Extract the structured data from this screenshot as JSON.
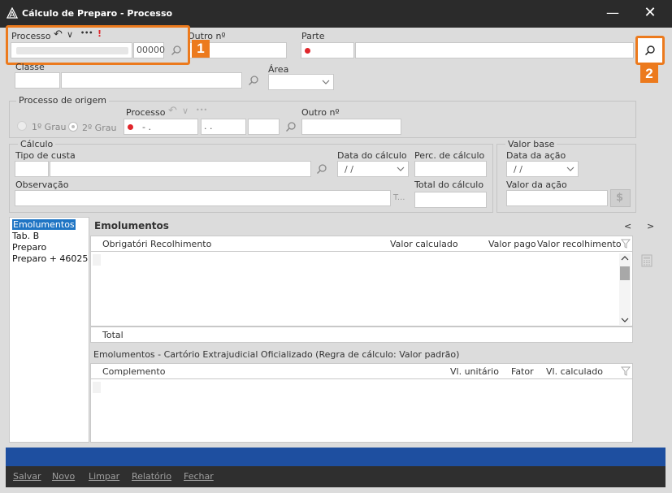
{
  "window": {
    "title": "Cálculo de Preparo - Processo",
    "minimize": "—",
    "close": "✕"
  },
  "processo": {
    "label": "Processo",
    "value_suffix": "00000",
    "outro_label": "Outro nº",
    "parte_label": "Parte",
    "back_icon": "↶",
    "chevron_icon": "∨",
    "more_icon": "•••",
    "alert_icon": "!"
  },
  "classe": {
    "label": "Classe",
    "area_label": "Área"
  },
  "origem": {
    "title": "Processo de origem",
    "grau1": "1º Grau",
    "grau2": "2º Grau",
    "processo_label": "Processo",
    "processo_mask": "- .",
    "processo_mask2": ". .",
    "outro_label": "Outro nº"
  },
  "calculo": {
    "title": "Cálculo",
    "tipo_label": "Tipo de custa",
    "data_label": "Data do cálculo",
    "data_value": "/ /",
    "perc_label": "Perc. de cálculo",
    "obs_label": "Observação",
    "obs_suffix": "T...",
    "total_label": "Total do cálculo"
  },
  "valor_base": {
    "title": "Valor base",
    "data_label": "Data da ação",
    "data_value": "/ /",
    "valor_label": "Valor da ação"
  },
  "left_list": [
    "Emolumentos",
    "Tab. B",
    "Preparo",
    "Preparo + 46025"
  ],
  "grid1": {
    "title": "Emolumentos",
    "nav_prev": "<",
    "nav_next": ">",
    "headers": [
      "Obrigatóri Recolhimento",
      "Valor calculado",
      "Valor pago",
      "Valor recolhimento"
    ],
    "total_label": "Total"
  },
  "grid2": {
    "title": "Emolumentos - Cartório Extrajudicial Oficializado (Regra de cálculo: Valor padrão)",
    "headers": [
      "Complemento",
      "Vl. unitário",
      "Fator",
      "Vl. calculado"
    ]
  },
  "footer": {
    "buttons": [
      "Salvar",
      "Novo",
      "Limpar",
      "Relatório",
      "Fechar"
    ]
  },
  "callouts": {
    "one": "1",
    "two": "2"
  },
  "colors": {
    "accent": "#ec7a1d",
    "selection": "#1f75c4",
    "status_bar": "#1e4fa0",
    "required": "#e0262b"
  }
}
